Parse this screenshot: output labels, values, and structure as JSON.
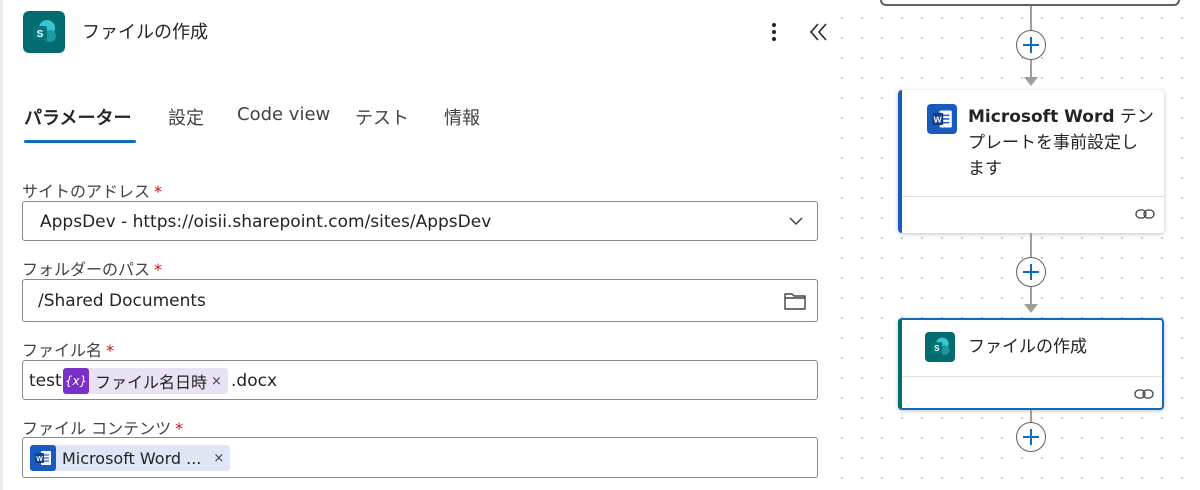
{
  "panel": {
    "title": "ファイルの作成",
    "tabs": [
      {
        "label": "パラメーター",
        "active": true
      },
      {
        "label": "設定",
        "active": false
      },
      {
        "label": "Code view",
        "active": false
      },
      {
        "label": "テスト",
        "active": false
      },
      {
        "label": "情報",
        "active": false
      }
    ],
    "fields": {
      "site": {
        "label": "サイトのアドレス",
        "value": "AppsDev - https://oisii.sharepoint.com/sites/AppsDev"
      },
      "folder": {
        "label": "フォルダーのパス",
        "value": "/Shared Documents"
      },
      "filename": {
        "label": "ファイル名",
        "prefix": "test",
        "token_label": "ファイル名日時",
        "token_icon_text": "{x}",
        "suffix": ".docx"
      },
      "content": {
        "label": "ファイル コンテンツ",
        "token_label": "Microsoft Word ..."
      }
    },
    "required_mark": "*",
    "remove_mark": "×"
  },
  "flow": {
    "cards": [
      {
        "title_bold": "Microsoft Word",
        "title_rest": " テンプレートを事前設定します",
        "icon": "word-icon"
      },
      {
        "title": "ファイルの作成",
        "icon": "sharepoint-icon"
      }
    ]
  },
  "colors": {
    "accent": "#0f6cbd",
    "sharepoint": "#036c70",
    "word": "#185abd",
    "expression": "#7b2fc9",
    "required": "#c50f1f"
  }
}
